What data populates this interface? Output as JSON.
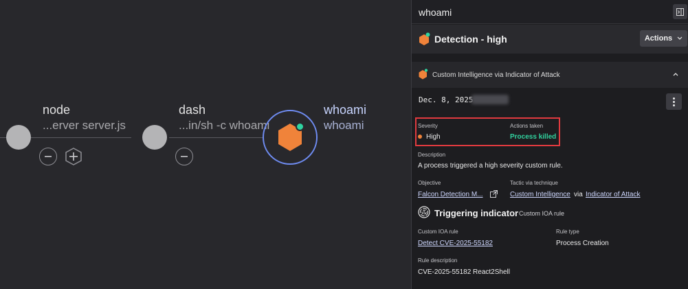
{
  "graph": {
    "nodes": [
      {
        "name": "node",
        "sub": "...erver server.js"
      },
      {
        "name": "dash",
        "sub": "...in/sh -c whoami"
      },
      {
        "name": "whoami",
        "sub": "whoami"
      }
    ]
  },
  "panel": {
    "header_title": "whoami",
    "detection_title": "Detection - high",
    "actions_label": "Actions",
    "section_title": "Custom Intelligence via Indicator of Attack",
    "date": "Dec. 8, 2025",
    "severity": {
      "label": "Severity",
      "value": "High"
    },
    "actions_taken": {
      "label": "Actions taken",
      "value": "Process killed"
    },
    "description": {
      "label": "Description",
      "value": "A process triggered a high severity custom rule."
    },
    "objective": {
      "label": "Objective",
      "value": "Falcon Detection M..."
    },
    "tactic": {
      "label": "Tactic via technique",
      "tactic": "Custom Intelligence",
      "via": "via",
      "technique": "Indicator of Attack"
    },
    "triggering": {
      "title": "Triggering indicator",
      "subtitle": "Custom IOA rule"
    },
    "ioa_rule": {
      "label": "Custom IOA rule",
      "value": "Detect CVE-2025-55182"
    },
    "rule_type": {
      "label": "Rule type",
      "value": "Process Creation"
    },
    "rule_description": {
      "label": "Rule description",
      "value": "CVE-2025-55182 React2Shell"
    }
  },
  "colors": {
    "accent_orange": "#f0833a",
    "status_green": "#31d39f",
    "focus_blue": "#6f8cf2",
    "highlight_red": "#e13a3f"
  },
  "icons": [
    "minus-circle-icon",
    "plus-hexagon-icon",
    "hexagon-detection-icon",
    "collapse-panel-icon",
    "chevron-down-icon",
    "chevron-up-icon",
    "kebab-menu-icon",
    "external-link-icon",
    "fingerprint-icon"
  ]
}
